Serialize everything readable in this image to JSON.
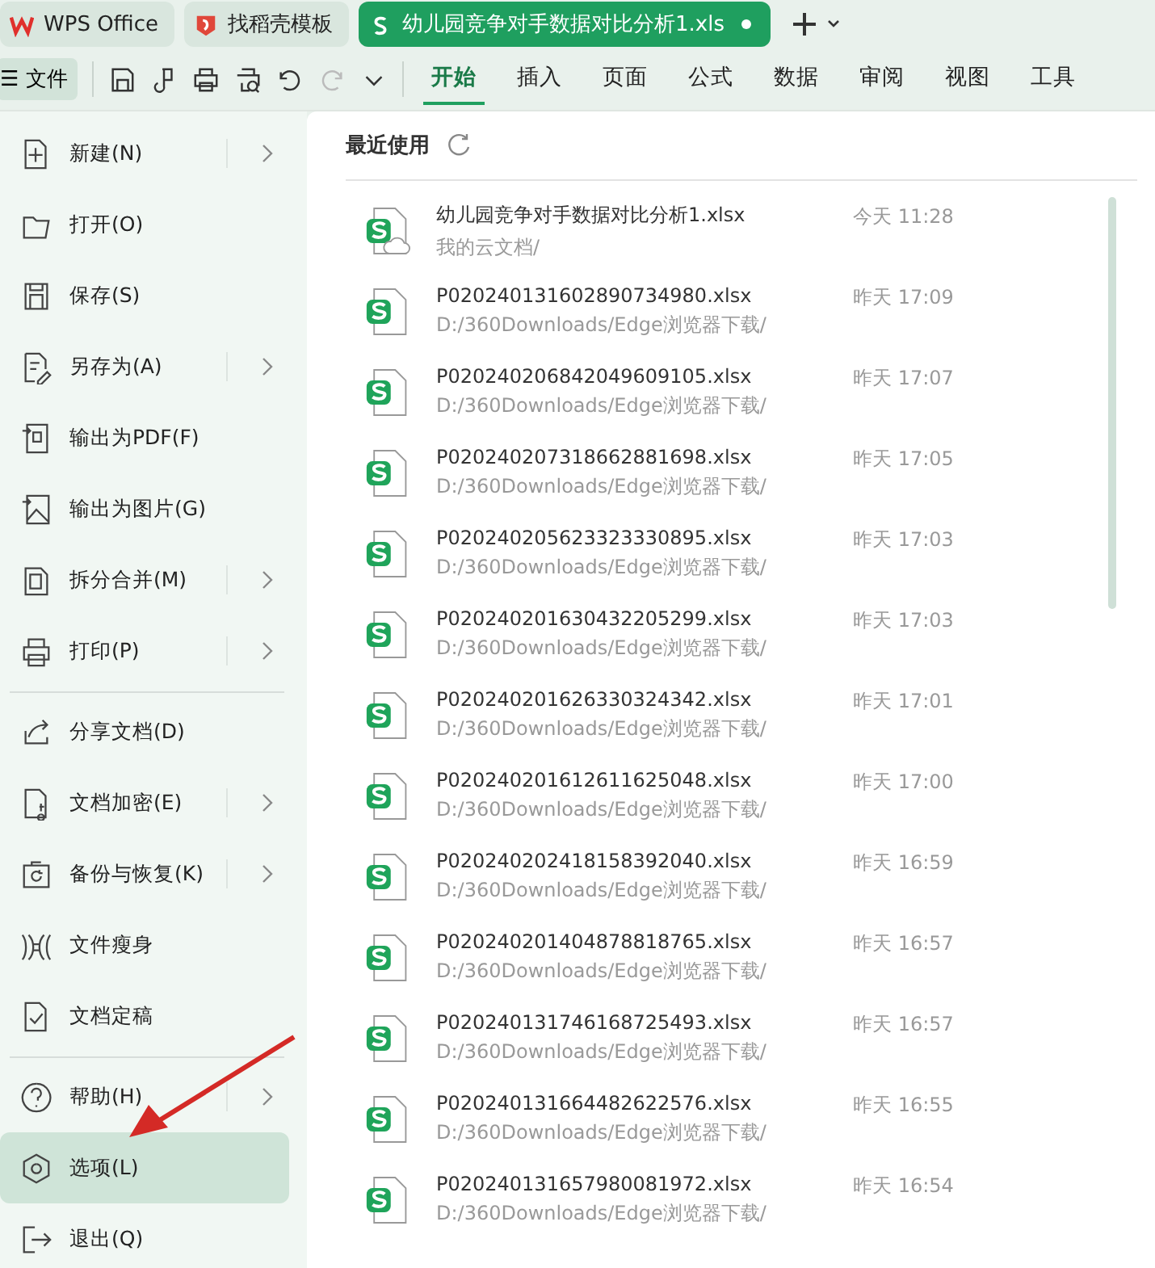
{
  "tabs": [
    {
      "label": "WPS Office",
      "kind": "home",
      "selected": false
    },
    {
      "label": "找稻壳模板",
      "kind": "template",
      "selected": false
    },
    {
      "label": "幼儿园竞争对手数据对比分析1.xls",
      "kind": "sheet",
      "selected": true,
      "unsaved": true
    }
  ],
  "file_button": {
    "label": "文件",
    "icon": "☰"
  },
  "ribbon_tabs": [
    {
      "label": "开始",
      "selected": true
    },
    {
      "label": "插入",
      "selected": false
    },
    {
      "label": "页面",
      "selected": false
    },
    {
      "label": "公式",
      "selected": false
    },
    {
      "label": "数据",
      "selected": false
    },
    {
      "label": "审阅",
      "selected": false
    },
    {
      "label": "视图",
      "selected": false
    },
    {
      "label": "工具",
      "selected": false
    }
  ],
  "menu_groups": [
    [
      {
        "label": "新建(N)",
        "submenu": true,
        "selected": false
      },
      {
        "label": "打开(O)",
        "submenu": false,
        "selected": false
      },
      {
        "label": "保存(S)",
        "submenu": false,
        "selected": false
      },
      {
        "label": "另存为(A)",
        "submenu": true,
        "selected": false
      },
      {
        "label": "输出为PDF(F)",
        "submenu": false,
        "selected": false
      },
      {
        "label": "输出为图片(G)",
        "submenu": false,
        "selected": false
      },
      {
        "label": "拆分合并(M)",
        "submenu": true,
        "selected": false
      },
      {
        "label": "打印(P)",
        "submenu": true,
        "selected": false
      }
    ],
    [
      {
        "label": "分享文档(D)",
        "submenu": false,
        "selected": false
      },
      {
        "label": "文档加密(E)",
        "submenu": true,
        "selected": false
      },
      {
        "label": "备份与恢复(K)",
        "submenu": true,
        "selected": false
      },
      {
        "label": "文件瘦身",
        "submenu": false,
        "selected": false
      },
      {
        "label": "文档定稿",
        "submenu": false,
        "selected": false
      }
    ],
    [
      {
        "label": "帮助(H)",
        "submenu": true,
        "selected": false
      },
      {
        "label": "选项(L)",
        "submenu": false,
        "selected": true
      },
      {
        "label": "退出(Q)",
        "submenu": false,
        "selected": false
      }
    ]
  ],
  "recent": {
    "title": "最近使用",
    "files": [
      {
        "name": "幼儿园竞争对手数据对比分析1.xlsx",
        "path": "我的云文档/",
        "time": "今天 11:28",
        "cloud": true
      },
      {
        "name": "P020240131602890734980.xlsx",
        "path": "D:/360Downloads/Edge浏览器下载/",
        "time": "昨天 17:09",
        "cloud": false
      },
      {
        "name": "P020240206842049609105.xlsx",
        "path": "D:/360Downloads/Edge浏览器下载/",
        "time": "昨天 17:07",
        "cloud": false
      },
      {
        "name": "P020240207318662881698.xlsx",
        "path": "D:/360Downloads/Edge浏览器下载/",
        "time": "昨天 17:05",
        "cloud": false
      },
      {
        "name": "P020240205623323330895.xlsx",
        "path": "D:/360Downloads/Edge浏览器下载/",
        "time": "昨天 17:03",
        "cloud": false
      },
      {
        "name": "P020240201630432205299.xlsx",
        "path": "D:/360Downloads/Edge浏览器下载/",
        "time": "昨天 17:03",
        "cloud": false
      },
      {
        "name": "P020240201626330324342.xlsx",
        "path": "D:/360Downloads/Edge浏览器下载/",
        "time": "昨天 17:01",
        "cloud": false
      },
      {
        "name": "P020240201612611625048.xlsx",
        "path": "D:/360Downloads/Edge浏览器下载/",
        "time": "昨天 17:00",
        "cloud": false
      },
      {
        "name": "P020240202418158392040.xlsx",
        "path": "D:/360Downloads/Edge浏览器下载/",
        "time": "昨天 16:59",
        "cloud": false
      },
      {
        "name": "P020240201404878818765.xlsx",
        "path": "D:/360Downloads/Edge浏览器下载/",
        "time": "昨天 16:57",
        "cloud": false
      },
      {
        "name": "P020240131746168725493.xlsx",
        "path": "D:/360Downloads/Edge浏览器下载/",
        "time": "昨天 16:57",
        "cloud": false
      },
      {
        "name": "P020240131664482622576.xlsx",
        "path": "D:/360Downloads/Edge浏览器下载/",
        "time": "昨天 16:55",
        "cloud": false
      },
      {
        "name": "P020240131657980081972.xlsx",
        "path": "D:/360Downloads/Edge浏览器下载/",
        "time": "昨天 16:54",
        "cloud": false
      }
    ]
  }
}
